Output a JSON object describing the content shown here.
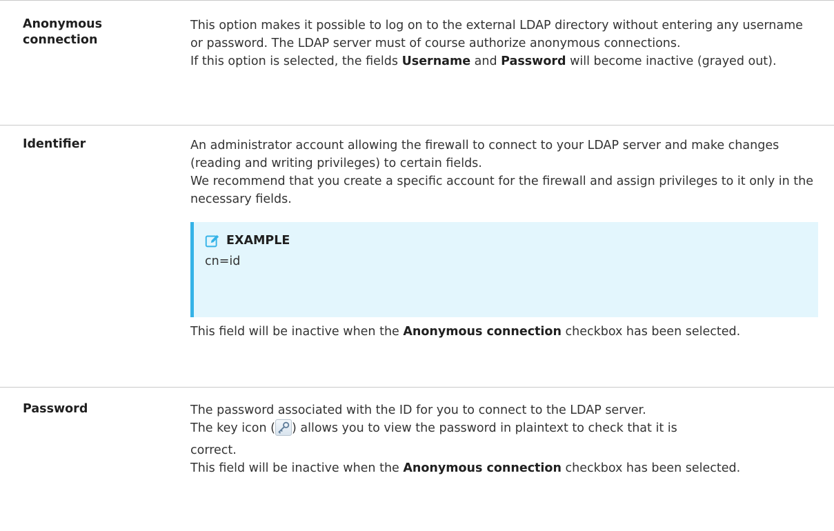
{
  "rows": [
    {
      "term": [
        "Anonymous",
        "connection"
      ],
      "desc": [
        "This option makes it possible to log on to the external LDAP directory without entering any username or password. The LDAP server must of course authorize anonymous connections.",
        "If this option is selected, the fields",
        "Username",
        "and",
        "Password",
        "will become inactive (grayed out)."
      ]
    },
    {
      "term": [
        "Identifier"
      ],
      "desc": [
        "An administrator account allowing the firewall to connect to your LDAP server and make changes (reading and writing privileges) to certain fields.",
        "We recommend that you create a specific account for the firewall and assign privileges to it only in the necessary fields.",
        "This field will be inactive when the",
        "Anonymous connection",
        "checkbox has been selected."
      ],
      "example": {
        "label": "EXAMPLE",
        "text": "cn=id"
      }
    },
    {
      "term": [
        "Password"
      ],
      "desc": [
        "The password associated with the ID for you to connect to the LDAP server.",
        "The key icon (",
        ") allows you to view the password in plaintext to check that it is",
        "correct.",
        "This field will be inactive when the",
        "Anonymous connection",
        "checkbox has been selected."
      ]
    }
  ],
  "colors": {
    "accent": "#35b3e7",
    "example_bg": "#e3f6fd",
    "divider": "#c9c9c9"
  },
  "icons": {
    "example": "pencil-icon",
    "key": "key-icon"
  }
}
